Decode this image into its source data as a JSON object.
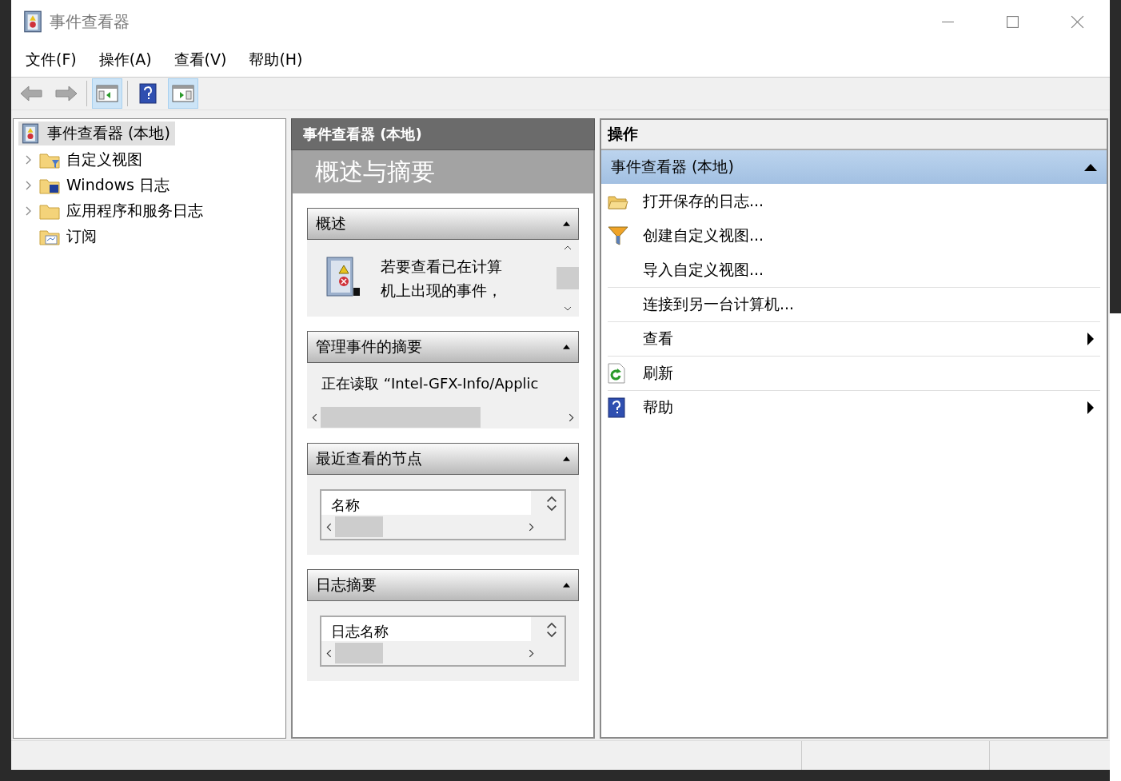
{
  "window": {
    "title": "事件查看器"
  },
  "menu": [
    "文件(F)",
    "操作(A)",
    "查看(V)",
    "帮助(H)"
  ],
  "toolbar": [
    {
      "kind": "back",
      "disabled": true,
      "selected": false
    },
    {
      "kind": "forward",
      "disabled": true,
      "selected": false
    },
    {
      "kind": "tree",
      "disabled": false,
      "selected": true
    },
    {
      "kind": "help",
      "disabled": false,
      "selected": false
    },
    {
      "kind": "pane",
      "disabled": false,
      "selected": true
    }
  ],
  "tree": {
    "root": {
      "label": "事件查看器 (本地)",
      "selected": true
    },
    "items": [
      {
        "label": "自定义视图",
        "kind": "folder",
        "expanded": false,
        "selected": false
      },
      {
        "label": "Windows 日志",
        "kind": "winlog",
        "expanded": false,
        "selected": false
      },
      {
        "label": "应用程序和服务日志",
        "kind": "folder",
        "expanded": false,
        "selected": false
      },
      {
        "label": "订阅",
        "kind": "subscription",
        "selected": false
      }
    ]
  },
  "center": {
    "header": "事件查看器 (本地)",
    "title": "概述与摘要",
    "sections": [
      {
        "title": "概述",
        "expanded": true,
        "kind": "overview",
        "text": "若要查看已在计算机上出现的事件，"
      },
      {
        "title": "管理事件的摘要",
        "expanded": true,
        "kind": "status",
        "text": "正在读取 “Intel-GFX-Info/Applic"
      },
      {
        "title": "最近查看的节点",
        "expanded": true,
        "kind": "list",
        "column": "名称"
      },
      {
        "title": "日志摘要",
        "expanded": true,
        "kind": "list",
        "column": "日志名称"
      }
    ]
  },
  "actions": {
    "header": "操作",
    "group": {
      "title": "事件查看器 (本地)",
      "expanded": true
    },
    "items": [
      {
        "label": "打开保存的日志...",
        "kind": "folder",
        "submenu": false,
        "divider_above": false
      },
      {
        "label": "创建自定义视图...",
        "kind": "filter",
        "submenu": false,
        "divider_above": false
      },
      {
        "label": "导入自定义视图...",
        "kind": "plain",
        "submenu": false,
        "divider_above": false
      },
      {
        "label": "连接到另一台计算机...",
        "kind": "plain",
        "submenu": false,
        "divider_above": true
      },
      {
        "label": "查看",
        "kind": "plain",
        "submenu": true,
        "divider_above": true
      },
      {
        "label": "刷新",
        "kind": "refresh",
        "submenu": false,
        "divider_above": true
      },
      {
        "label": "帮助",
        "kind": "help",
        "submenu": true,
        "divider_above": true
      }
    ]
  }
}
